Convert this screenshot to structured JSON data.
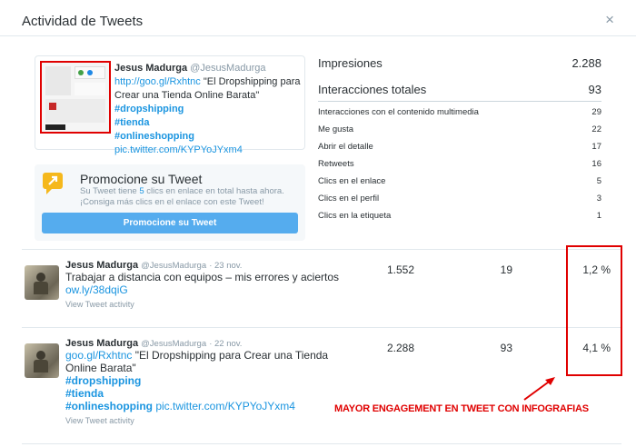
{
  "modal": {
    "title": "Actividad de Tweets",
    "close_glyph": "×"
  },
  "featured_tweet": {
    "author_name": "Jesus Madurga",
    "handle": "@JesusMadurga",
    "link": "http://goo.gl/Rxhtnc",
    "text": " \"El Dropshipping para Crear una Tienda Online Barata\"",
    "hashtags": [
      "#dropshipping",
      "#tienda",
      "#onlineshopping"
    ],
    "pic_link": "pic.twitter.com/KYPYoJYxm4"
  },
  "promotion": {
    "title": "Promocione su Tweet",
    "desc_part1": "Su Tweet tiene ",
    "desc_clicks": "5",
    "desc_part2": " clics en enlace en total hasta ahora. ¡Consiga más clics en el enlace con este Tweet!",
    "button_label": "Promocione su Tweet"
  },
  "summary": {
    "impressions_label": "Impresiones",
    "impressions_value": "2.288",
    "interactions_label": "Interacciones totales",
    "interactions_value": "93",
    "breakdown": [
      {
        "label": "Interacciones con el contenido multimedia",
        "value": "29"
      },
      {
        "label": "Me gusta",
        "value": "22"
      },
      {
        "label": "Abrir el detalle",
        "value": "17"
      },
      {
        "label": "Retweets",
        "value": "16"
      },
      {
        "label": "Clics en el enlace",
        "value": "5"
      },
      {
        "label": "Clics en el perfil",
        "value": "3"
      },
      {
        "label": "Clics en la etiqueta",
        "value": "1"
      }
    ]
  },
  "tweets": [
    {
      "author_name": "Jesus Madurga",
      "handle": "@JesusMadurga",
      "date": "· 23 nov.",
      "text": "Trabajar a distancia con equipos – mis errores y aciertos",
      "link": "ow.ly/38dqiG",
      "view_activity": "View Tweet activity",
      "impressions": "1.552",
      "engagements": "19",
      "rate": "1,2 %"
    },
    {
      "author_name": "Jesus Madurga",
      "handle": "@JesusMadurga",
      "date": "· 22 nov.",
      "link": "goo.gl/Rxhtnc",
      "text": " \"El Dropshipping para Crear una Tienda Online Barata\"",
      "hashtags": [
        "#dropshipping",
        "#tienda",
        "#onlineshopping"
      ],
      "pic_link": " pic.twitter.com/KYPYoJYxm4",
      "view_activity": "View Tweet activity",
      "impressions": "2.288",
      "engagements": "93",
      "rate": "4,1 %"
    }
  ],
  "annotation": {
    "text": "MAYOR ENGAGEMENT EN TWEET CON INFOGRAFIAS",
    "color": "#e00000"
  },
  "colors": {
    "link": "#1b95e0",
    "button": "#55acee",
    "muted": "#8899a6"
  }
}
